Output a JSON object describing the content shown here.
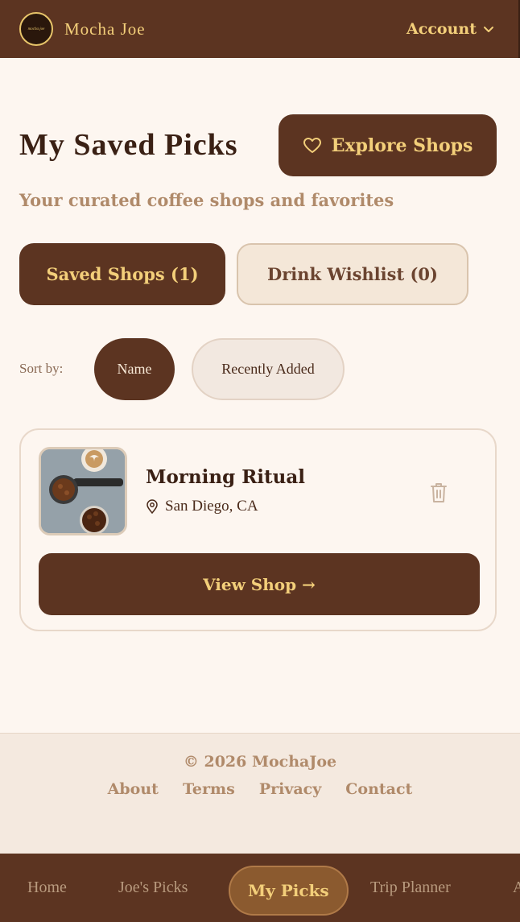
{
  "header": {
    "logo_text": "mocha joe",
    "brand": "Mocha Joe",
    "account_label": "Account"
  },
  "main": {
    "title": "My Saved Picks",
    "explore_label": "Explore Shops",
    "subtitle": "Your curated coffee shops and favorites",
    "tabs": [
      {
        "label": "Saved Shops (1)",
        "active": true
      },
      {
        "label": "Drink Wishlist (0)",
        "active": false
      }
    ],
    "sort": {
      "label": "Sort by:",
      "options": [
        {
          "label": "Name",
          "active": true
        },
        {
          "label": "Recently Added",
          "active": false
        }
      ]
    },
    "shops": [
      {
        "name": "Morning Ritual",
        "location": "San Diego, CA",
        "view_label": "View Shop →"
      }
    ]
  },
  "footer": {
    "copyright": "© 2026 MochaJoe",
    "links": [
      "About",
      "Terms",
      "Privacy",
      "Contact"
    ]
  },
  "bottom_nav": {
    "items": [
      "Home",
      "Joe's Picks",
      "My Picks",
      "Trip Planner",
      "A"
    ],
    "active": "My Picks"
  },
  "colors": {
    "primary": "#5c3421",
    "accent": "#f3cf7a",
    "background": "#fdf6f0"
  }
}
